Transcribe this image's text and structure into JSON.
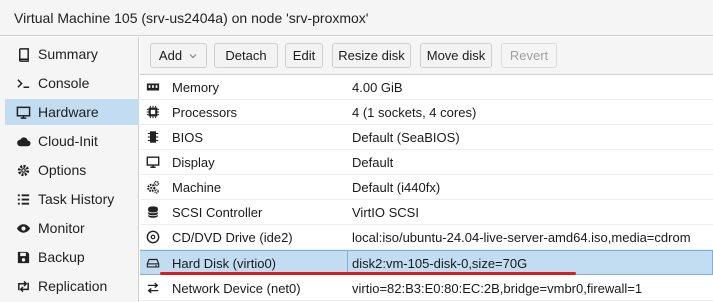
{
  "window": {
    "title": "Virtual Machine 105 (srv-us2404a) on node 'srv-proxmox'"
  },
  "sidebar": {
    "items": [
      {
        "label": "Summary",
        "icon": "book-icon"
      },
      {
        "label": "Console",
        "icon": "terminal-icon"
      },
      {
        "label": "Hardware",
        "icon": "monitor-icon",
        "active": true
      },
      {
        "label": "Cloud-Init",
        "icon": "cloud-icon"
      },
      {
        "label": "Options",
        "icon": "gear-icon"
      },
      {
        "label": "Task History",
        "icon": "list-icon"
      },
      {
        "label": "Monitor",
        "icon": "eye-icon"
      },
      {
        "label": "Backup",
        "icon": "floppy-icon"
      },
      {
        "label": "Replication",
        "icon": "retweet-icon"
      }
    ]
  },
  "toolbar": {
    "add_label": "Add",
    "detach_label": "Detach",
    "edit_label": "Edit",
    "resize_label": "Resize disk",
    "move_label": "Move disk",
    "revert_label": "Revert"
  },
  "hardware": {
    "rows": [
      {
        "key": "Memory",
        "value": "4.00 GiB",
        "icon": "memory-icon"
      },
      {
        "key": "Processors",
        "value": "4 (1 sockets, 4 cores)",
        "icon": "cpu-icon"
      },
      {
        "key": "BIOS",
        "value": "Default (SeaBIOS)",
        "icon": "chip-icon"
      },
      {
        "key": "Display",
        "value": "Default",
        "icon": "desktop-icon"
      },
      {
        "key": "Machine",
        "value": "Default (i440fx)",
        "icon": "cogs-icon"
      },
      {
        "key": "SCSI Controller",
        "value": "VirtIO SCSI",
        "icon": "database-icon"
      },
      {
        "key": "CD/DVD Drive (ide2)",
        "value": "local:iso/ubuntu-24.04-live-server-amd64.iso,media=cdrom",
        "icon": "cdrom-icon"
      },
      {
        "key": "Hard Disk (virtio0)",
        "value": "disk2:vm-105-disk-0,size=70G",
        "icon": "hdd-icon",
        "selected": true
      },
      {
        "key": "Network Device (net0)",
        "value": "virtio=82:B3:E0:80:EC:2B,bridge=vmbr0,firewall=1",
        "icon": "exchange-icon"
      }
    ]
  },
  "colors": {
    "selection": "#c2ddf2",
    "annotation_underline": "#d41f1f"
  }
}
